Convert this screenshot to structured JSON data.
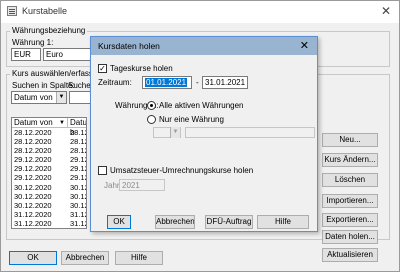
{
  "window": {
    "title": "Kurstabelle"
  },
  "currency_relation": {
    "group_label": "Währungsbeziehung",
    "currency1_label": "Währung 1:",
    "currency1_code": "EUR",
    "currency1_name": "Euro"
  },
  "rate_select": {
    "group_label": "Kurs auswählen/erfassen",
    "search_column_label": "Suchen in Spalte:",
    "search_label": "Suchen",
    "search_column_value": "Datum von",
    "list": {
      "col1_header": "Datum von",
      "col2_header": "Datum b",
      "col1_values": [
        "28.12.2020",
        "28.12.2020",
        "28.12.2020",
        "29.12.2020",
        "29.12.2020",
        "29.12.2020",
        "30.12.2020",
        "30.12.2020",
        "30.12.2020",
        "31.12.2020",
        "31.12.2020",
        "31.12.2020"
      ],
      "col2_values": [
        "28.12.20",
        "28.12.20",
        "28.12.20",
        "29.12.20",
        "29.12.20",
        "29.12.20",
        "30.12.20",
        "30.12.20",
        "30.12.20",
        "31.12.20",
        "31.12.20",
        "31.12.20"
      ]
    }
  },
  "side_buttons": {
    "new": "Neu...",
    "change": "Kurs Ändern...",
    "delete": "Löschen",
    "import": "Importieren...",
    "export": "Exportieren...",
    "fetch": "Daten holen...",
    "refresh": "Aktualisieren"
  },
  "bottom_buttons": {
    "ok": "OK",
    "cancel": "Abbrechen",
    "help": "Hilfe"
  },
  "dialog": {
    "title": "Kursdaten holen",
    "daily_rates_label": "Tageskurse holen",
    "daily_rates_checked": true,
    "period_label": "Zeitraum:",
    "date_from": "01.01.2021",
    "date_separator": "-",
    "date_to": "31.01.2021",
    "currencies_label": "Währungen:",
    "radio_all": "Alle aktiven Währungen",
    "radio_one": "Nur eine Währung",
    "vat_label": "Umsatzsteuer-Umrechnungskurse holen",
    "vat_checked": false,
    "year_label": "Jahr:",
    "year_value": "2021",
    "ok": "OK",
    "cancel": "Abbrechen",
    "dfue": "DFÜ-Auftrag",
    "help": "Hilfe"
  }
}
